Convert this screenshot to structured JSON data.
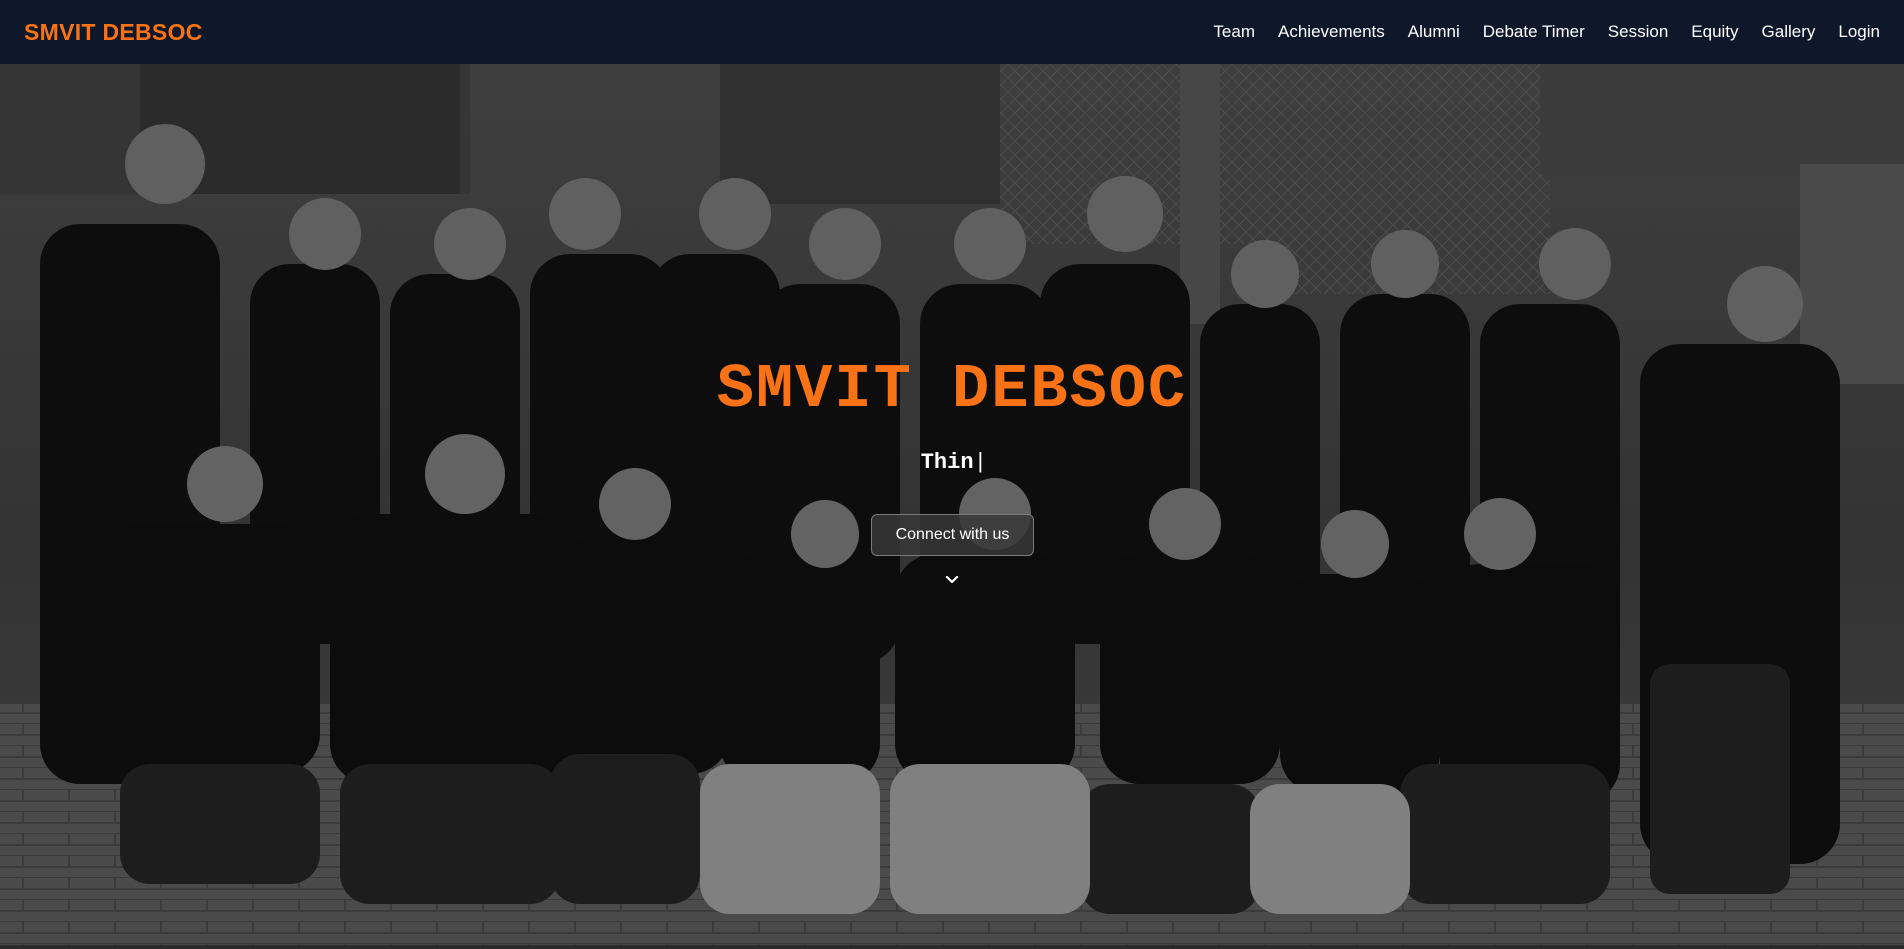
{
  "navbar": {
    "brand": "SMVIT DEBSOC",
    "links": [
      "Team",
      "Achievements",
      "Alumni",
      "Debate Timer",
      "Session",
      "Equity",
      "Gallery",
      "Login"
    ]
  },
  "hero": {
    "title": "SMVIT DEBSOC",
    "typed_text": "Thin",
    "cursor": "|",
    "cta_label": "Connect with us",
    "scroll_icon": "chevron-down-icon"
  },
  "colors": {
    "navbar_bg": "#0f172a",
    "accent": "#f97316",
    "text": "#ffffff"
  }
}
